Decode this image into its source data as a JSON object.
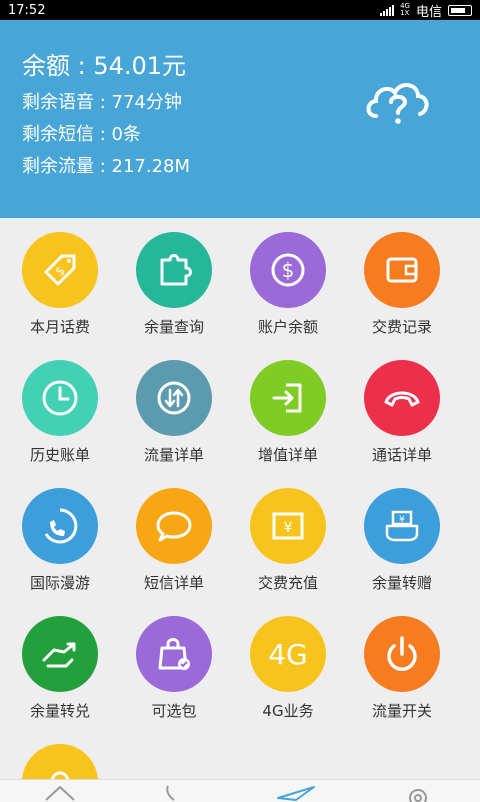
{
  "status_bar": {
    "time": "17:52",
    "network": [
      "4G",
      "1X"
    ],
    "carrier": "电信"
  },
  "header": {
    "balance": "余额 : 54.01元",
    "voice": "剩余语音 : 774分钟",
    "sms": "剩余短信 : 0条",
    "data": "剩余流量 : 217.28M",
    "help_icon": "cloud-question-icon"
  },
  "colors": {
    "header_bg": "#47a6d7",
    "yellow": "#f7c31d",
    "teal": "#25b79a",
    "purple": "#9a6ad8",
    "orange": "#f77c1f",
    "mint": "#43d1b5",
    "slate": "#5c9aad",
    "green": "#7fcc24",
    "red": "#ec2f4b",
    "blue": "#3d9edc",
    "amber": "#f7a713",
    "darkgreen": "#21a03b"
  },
  "grid": {
    "items": [
      {
        "label": "本月话费",
        "icon": "price-tag-icon",
        "color": "#f7c31d"
      },
      {
        "label": "余量查询",
        "icon": "puzzle-icon",
        "color": "#25b79a"
      },
      {
        "label": "账户余额",
        "icon": "dollar-coin-icon",
        "color": "#9a6ad8"
      },
      {
        "label": "交费记录",
        "icon": "wallet-icon",
        "color": "#f77c1f"
      },
      {
        "label": "历史账单",
        "icon": "clock-icon",
        "color": "#43d1b5"
      },
      {
        "label": "流量详单",
        "icon": "up-down-arrows-icon",
        "color": "#5c9aad"
      },
      {
        "label": "增值详单",
        "icon": "enter-door-icon",
        "color": "#7fcc24"
      },
      {
        "label": "通话详单",
        "icon": "phone-hangup-icon",
        "color": "#ec2f4b"
      },
      {
        "label": "国际漫游",
        "icon": "globe-phone-icon",
        "color": "#3d9edc"
      },
      {
        "label": "短信详单",
        "icon": "chat-bubble-icon",
        "color": "#f7a713"
      },
      {
        "label": "交费充值",
        "icon": "yuan-card-icon",
        "color": "#f7c31d"
      },
      {
        "label": "余量转赠",
        "icon": "hand-money-icon",
        "color": "#3d9edc"
      },
      {
        "label": "余量转兑",
        "icon": "exchange-hand-icon",
        "color": "#21a03b"
      },
      {
        "label": "可选包",
        "icon": "shopping-bag-icon",
        "color": "#9a6ad8"
      },
      {
        "label": "4G业务",
        "icon": "4g-icon",
        "icon_text": "4G",
        "color": "#f7c31d"
      },
      {
        "label": "流量开关",
        "icon": "power-icon",
        "color": "#f77c1f"
      },
      {
        "label": "",
        "icon": "partial-icon",
        "color": "#f7c31d"
      }
    ]
  },
  "bottom_nav": {
    "items": [
      "home-icon",
      "phone-icon",
      "send-icon",
      "settings-icon"
    ]
  }
}
